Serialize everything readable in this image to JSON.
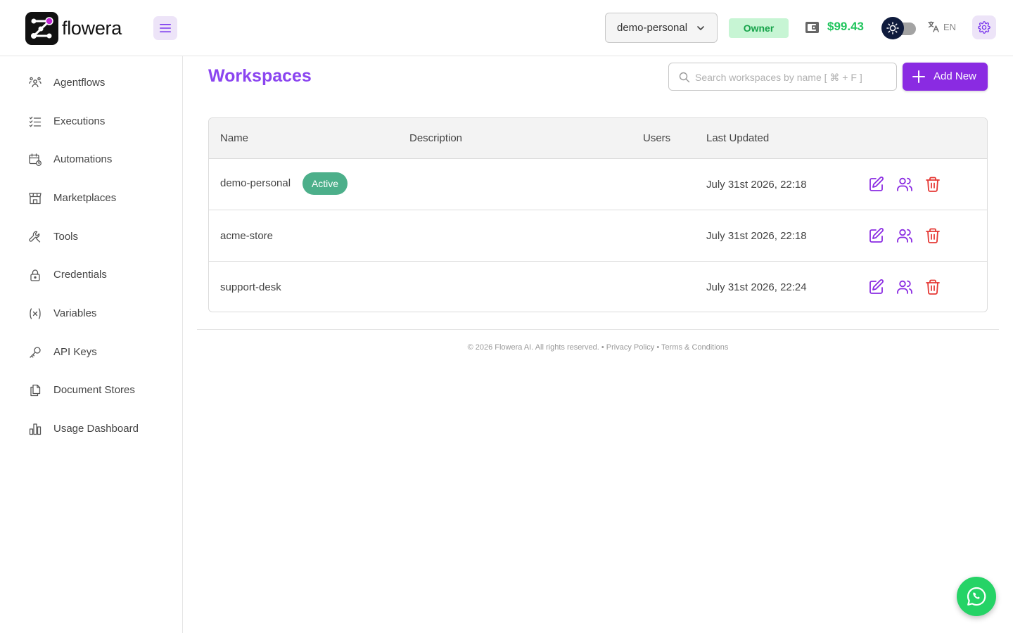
{
  "app": {
    "name": "flowera"
  },
  "header": {
    "workspace_selected": "demo-personal",
    "role": "Owner",
    "balance": "$99.43",
    "language": "EN"
  },
  "sidebar": {
    "items": [
      {
        "label": "Agentflows",
        "icon": "agents-icon"
      },
      {
        "label": "Executions",
        "icon": "executions-list-icon"
      },
      {
        "label": "Automations",
        "icon": "calendar-clock-icon"
      },
      {
        "label": "Marketplaces",
        "icon": "store-icon"
      },
      {
        "label": "Tools",
        "icon": "wrench-icon"
      },
      {
        "label": "Credentials",
        "icon": "lock-icon"
      },
      {
        "label": "Variables",
        "icon": "variable-icon"
      },
      {
        "label": "API Keys",
        "icon": "key-icon"
      },
      {
        "label": "Document Stores",
        "icon": "documents-icon"
      },
      {
        "label": "Usage Dashboard",
        "icon": "bar-chart-icon"
      }
    ]
  },
  "main": {
    "title": "Workspaces",
    "search_placeholder": "Search workspaces by name [ ⌘ + F ]",
    "add_label": "Add New",
    "table": {
      "columns": [
        "Name",
        "Description",
        "Users",
        "Last Updated"
      ],
      "rows": [
        {
          "name": "demo-personal",
          "badge": "Active",
          "description": "",
          "users": "",
          "updated": "July 31st 2026, 22:18"
        },
        {
          "name": "acme-store",
          "description": "",
          "users": "",
          "updated": "July 31st 2026, 22:18"
        },
        {
          "name": "support-desk",
          "description": "",
          "users": "",
          "updated": "July 31st 2026, 22:24"
        }
      ]
    }
  },
  "footer": {
    "copyright": "© 2026 Flowera AI. All rights reserved.",
    "sep": "•",
    "privacy": "Privacy Policy",
    "terms": "Terms & Conditions"
  },
  "colors": {
    "accent": "#8a2be2",
    "title": "#8b45f0",
    "success": "#22c55e",
    "danger": "#e53935",
    "active_badge": "#4caf8a"
  }
}
